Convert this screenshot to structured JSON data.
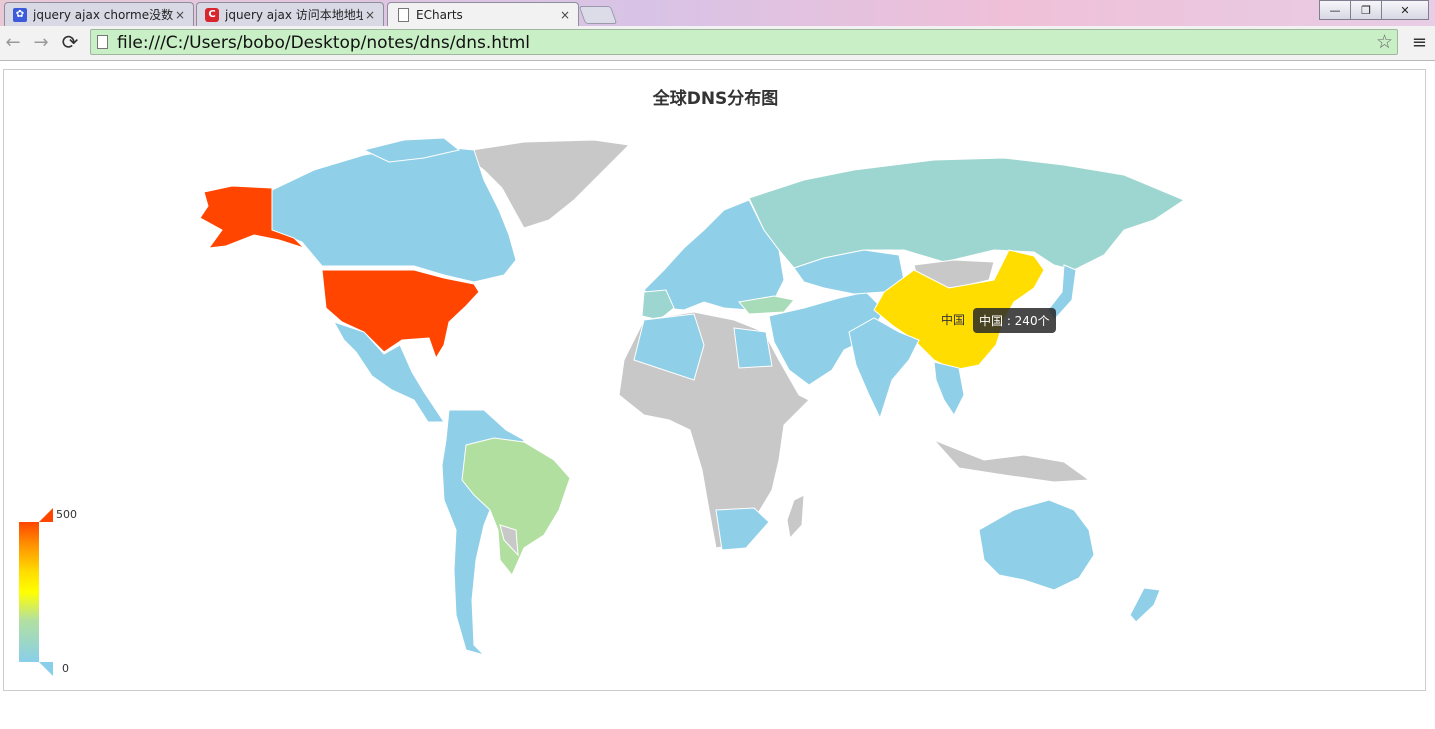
{
  "browser": {
    "tabs": [
      {
        "title": "jquery ajax chorme没数",
        "favicon": "paw-icon",
        "close": "×"
      },
      {
        "title": "jquery ajax 访问本地地址",
        "favicon": "csdn-c-icon",
        "close": "×"
      },
      {
        "title": "ECharts",
        "favicon": "page-icon",
        "close": "×",
        "active": true
      }
    ],
    "window_buttons": [
      "—",
      "❐",
      "✕"
    ],
    "back": "←",
    "forward": "→",
    "reload": "⟳",
    "url": "file:///C:/Users/bobo/Desktop/notes/dns/dns.html",
    "bookmark": "☆",
    "menu": "≡"
  },
  "chart_data": {
    "type": "map",
    "title": "全球DNS分布图",
    "visual_map": {
      "min": 0,
      "max": 500,
      "min_label": "0",
      "max_label": "500",
      "colors": [
        "#89cfea",
        "#b3e0a0",
        "#ffff00",
        "#ffdb00",
        "#ff8c00",
        "#ff4500"
      ]
    },
    "regions": [
      {
        "name": "United States",
        "value": 480,
        "color": "#ff4500"
      },
      {
        "name": "中国",
        "value": 240,
        "color": "#ffdd00"
      },
      {
        "name": "Brazil",
        "value": 55,
        "color": "#b1dfa0"
      },
      {
        "name": "Russia",
        "value": 35,
        "color": "#9dd6d0"
      },
      {
        "name": "Turkey",
        "value": 40,
        "color": "#a8dbb8"
      },
      {
        "name": "Canada",
        "value": 15,
        "color": "#8fcfe8"
      },
      {
        "name": "Australia",
        "value": 15,
        "color": "#8fcfe8"
      },
      {
        "name": "India",
        "value": 15,
        "color": "#8fcfe8"
      },
      {
        "name": "Greenland",
        "value": null,
        "color": "#c8c8c8"
      },
      {
        "name": "Africa",
        "value": null,
        "color": "#c8c8c8"
      }
    ],
    "tooltip": {
      "name": "中国",
      "value": "240",
      "unit": "个",
      "text": "中国 : 240个"
    },
    "highlight_label": "中国"
  }
}
